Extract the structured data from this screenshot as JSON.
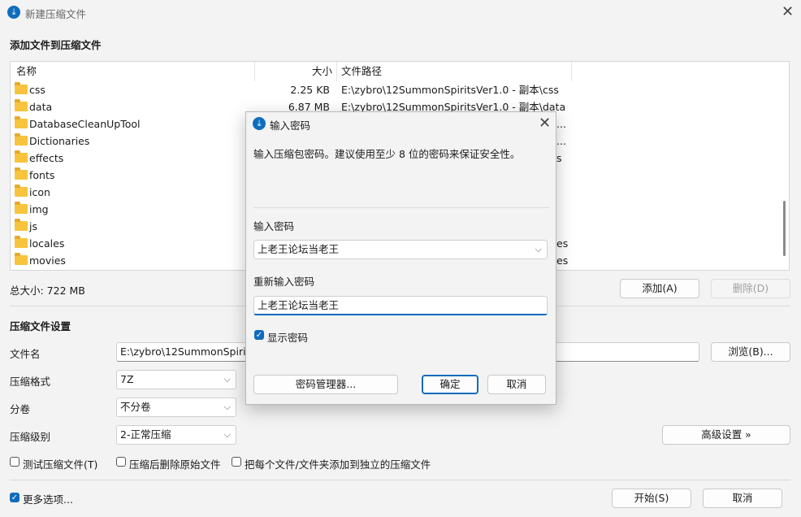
{
  "window": {
    "title": "新建压缩文件"
  },
  "add_section": {
    "title": "添加文件到压缩文件"
  },
  "file_list": {
    "columns": [
      "名称",
      "大小",
      "文件路径"
    ],
    "rows": [
      {
        "name": "css",
        "size": "2.25 KB",
        "path": "E:\\zybro\\12SummonSpiritsVer1.0 - 副本\\css"
      },
      {
        "name": "data",
        "size": "6.87 MB",
        "path": "E:\\zybro\\12SummonSpiritsVer1.0 - 副本\\data"
      },
      {
        "name": "DatabaseCleanUpTool",
        "size": "",
        "path": "..."
      },
      {
        "name": "Dictionaries",
        "size": "",
        "path": "..."
      },
      {
        "name": "effects",
        "size": "",
        "path": "s"
      },
      {
        "name": "fonts",
        "size": "",
        "path": ""
      },
      {
        "name": "icon",
        "size": "",
        "path": ""
      },
      {
        "name": "img",
        "size": "",
        "path": ""
      },
      {
        "name": "js",
        "size": "",
        "path": ""
      },
      {
        "name": "locales",
        "size": "",
        "path": "es"
      },
      {
        "name": "movies",
        "size": "",
        "path": "es"
      }
    ]
  },
  "total_size": "总大小: 722 MB",
  "buttons": {
    "add": "添加(A)",
    "delete": "删除(D)",
    "browse": "浏览(B)...",
    "advanced": "高级设置 »",
    "start": "开始(S)",
    "cancel": "取消"
  },
  "settings": {
    "title": "压缩文件设置",
    "filename_label": "文件名",
    "filename_value": "E:\\zybro\\12SummonSpirits",
    "format_label": "压缩格式",
    "format_value": "7Z",
    "volume_label": "分卷",
    "volume_value": "不分卷",
    "level_label": "压缩级别",
    "level_value": "2-正常压缩"
  },
  "options": {
    "test": "测试压缩文件(T)",
    "delete_after": "压缩后删除原始文件",
    "separate": "把每个文件/文件夹添加到独立的压缩文件",
    "more": "更多选项..."
  },
  "dialog": {
    "title": "输入密码",
    "description": "输入压缩包密码。建议使用至少 8 位的密码来保证安全性。",
    "password_label": "输入密码",
    "password_value": "上老王论坛当老王",
    "confirm_label": "重新输入密码",
    "confirm_value": "上老王论坛当老王",
    "show_password": "显示密码",
    "manager_button": "密码管理器...",
    "ok_button": "确定",
    "cancel_button": "取消"
  },
  "colors": {
    "accent": "#0f6cbd",
    "folder": "#f8c43d"
  },
  "icons": {
    "app": "archive-app-icon",
    "close": "close-icon",
    "folder": "folder-icon",
    "chevron": "chevron-down-icon",
    "check": "checkmark-icon"
  }
}
